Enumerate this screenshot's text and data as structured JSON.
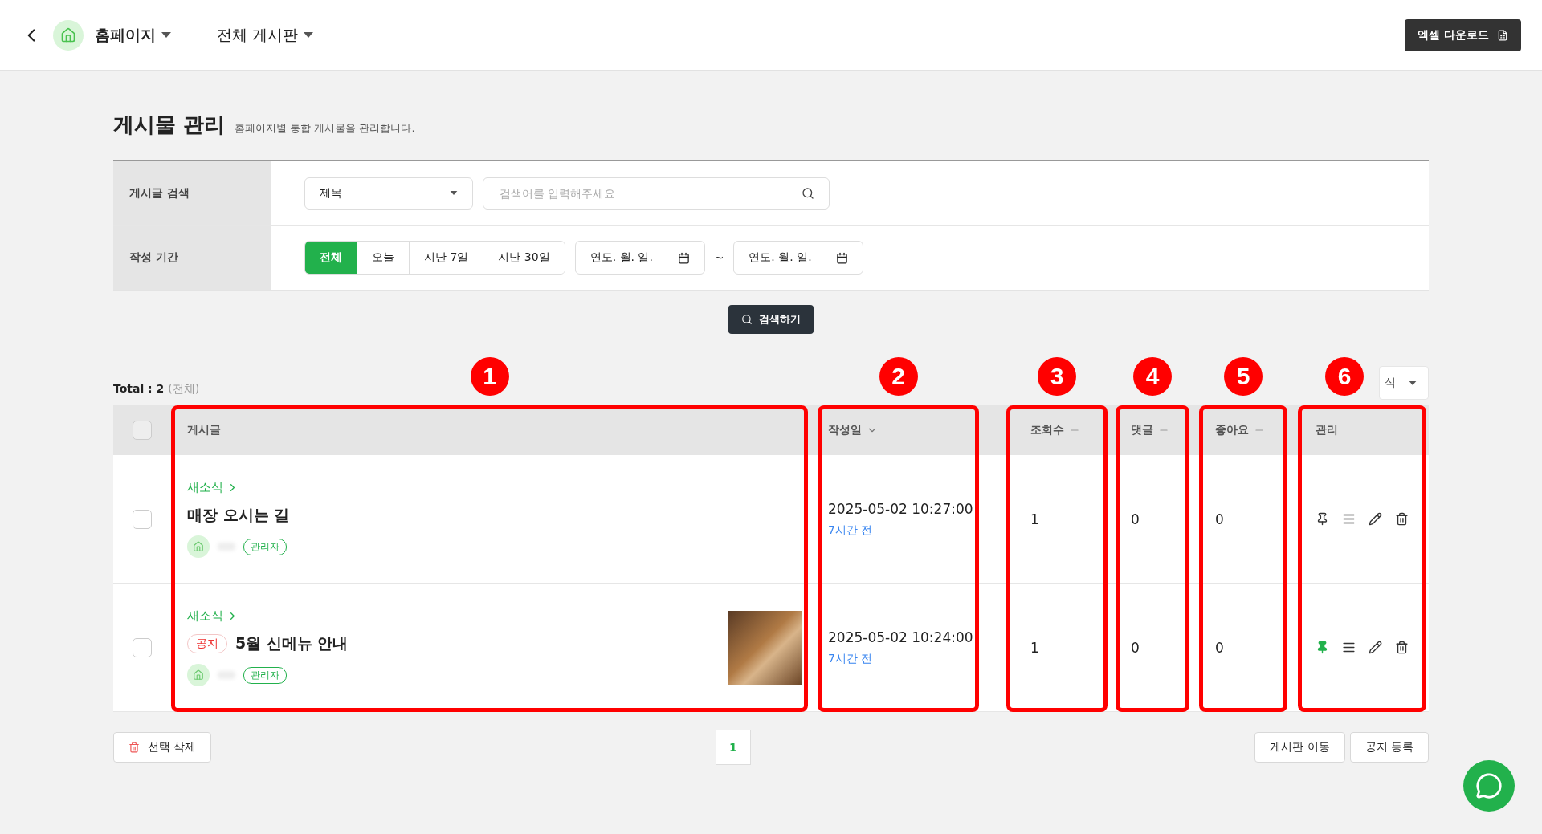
{
  "topbar": {
    "site": "홈페이지",
    "board": "전체 게시판",
    "excel_button": "엑셀 다운로드"
  },
  "page": {
    "title": "게시물 관리",
    "subtitle": "홈페이지별 통합 게시물을 관리합니다."
  },
  "filters": {
    "search_label": "게시글 검색",
    "field_select": "제목",
    "search_placeholder": "검색어를 입력해주세요",
    "period_label": "작성 기간",
    "periods": [
      {
        "label": "전체",
        "selected": true
      },
      {
        "label": "오늘",
        "selected": false
      },
      {
        "label": "지난 7일",
        "selected": false
      },
      {
        "label": "지난 30일",
        "selected": false
      }
    ],
    "date_from": "연도. 월. 일.",
    "separator": "~",
    "date_to": "연도. 월. 일.",
    "search_button": "검색하기"
  },
  "total": {
    "label": "Total : 2",
    "note": "(전체)"
  },
  "sort_select": "식",
  "table": {
    "select_all": false,
    "columns": [
      {
        "label": "게시글",
        "kind": "plain"
      },
      {
        "label": "작성일",
        "kind": "sorted"
      },
      {
        "label": "조회수",
        "kind": "sortable"
      },
      {
        "label": "댓글",
        "kind": "sortable"
      },
      {
        "label": "좋아요",
        "kind": "sortable"
      },
      {
        "label": "관리",
        "kind": "plain"
      }
    ],
    "rows": [
      {
        "checked": false,
        "category": "새소식",
        "notice": null,
        "title": "매장 오시는 길",
        "role": "관리자",
        "image": false,
        "date": "2025-05-02 10:27:00",
        "ago": "7시간 전",
        "views": "1",
        "comments": "0",
        "likes": "0",
        "pinned": false
      },
      {
        "checked": false,
        "category": "새소식",
        "notice": "공지",
        "title": "5월 신메뉴 안내",
        "role": "관리자",
        "image": true,
        "date": "2025-05-02 10:24:00",
        "ago": "7시간 전",
        "views": "1",
        "comments": "0",
        "likes": "0",
        "pinned": true
      }
    ]
  },
  "footer": {
    "delete_button": "선택 삭제",
    "pages": [
      {
        "label": "1",
        "selected": true
      }
    ],
    "move_button": "게시판 이동",
    "notice_button": "공지 등록"
  },
  "annotations": [
    {
      "number": "1"
    },
    {
      "number": "2"
    },
    {
      "number": "3"
    },
    {
      "number": "4"
    },
    {
      "number": "5"
    },
    {
      "number": "6"
    }
  ]
}
